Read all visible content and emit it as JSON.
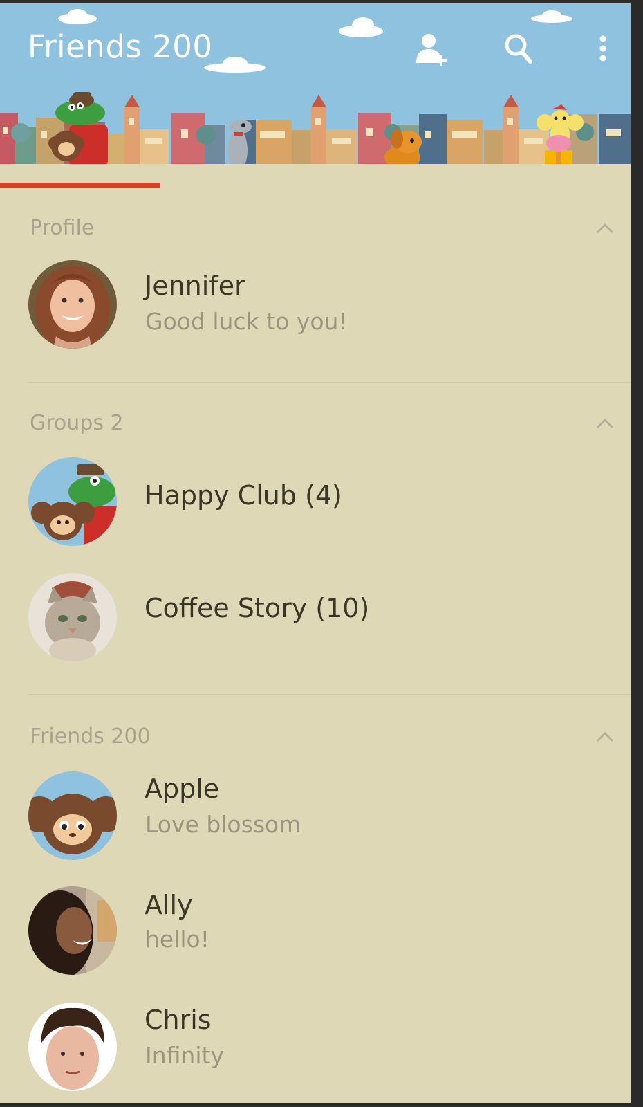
{
  "app": {
    "title": "Friends 200",
    "accent_color": "#d84126",
    "header_color": "#8fc2de",
    "background_color": "#dfd8b7"
  },
  "header_actions": [
    {
      "icon": "add-friend-icon"
    },
    {
      "icon": "search-icon"
    },
    {
      "icon": "more-vert-icon"
    }
  ],
  "sections": {
    "profile": {
      "label": "Profile",
      "icon": "chevron-up-icon",
      "user": {
        "name": "Jennifer",
        "status": "Good luck to you!"
      }
    },
    "groups": {
      "label": "Groups 2",
      "icon": "chevron-up-icon",
      "items": [
        {
          "name": "Happy Club (4)"
        },
        {
          "name": "Coffee Story (10)"
        }
      ]
    },
    "friends": {
      "label": "Friends 200",
      "icon": "chevron-up-icon",
      "items": [
        {
          "name": "Apple",
          "status": "Love blossom"
        },
        {
          "name": "Ally",
          "status": "hello!"
        },
        {
          "name": "Chris",
          "status": "Infinity"
        }
      ]
    }
  }
}
